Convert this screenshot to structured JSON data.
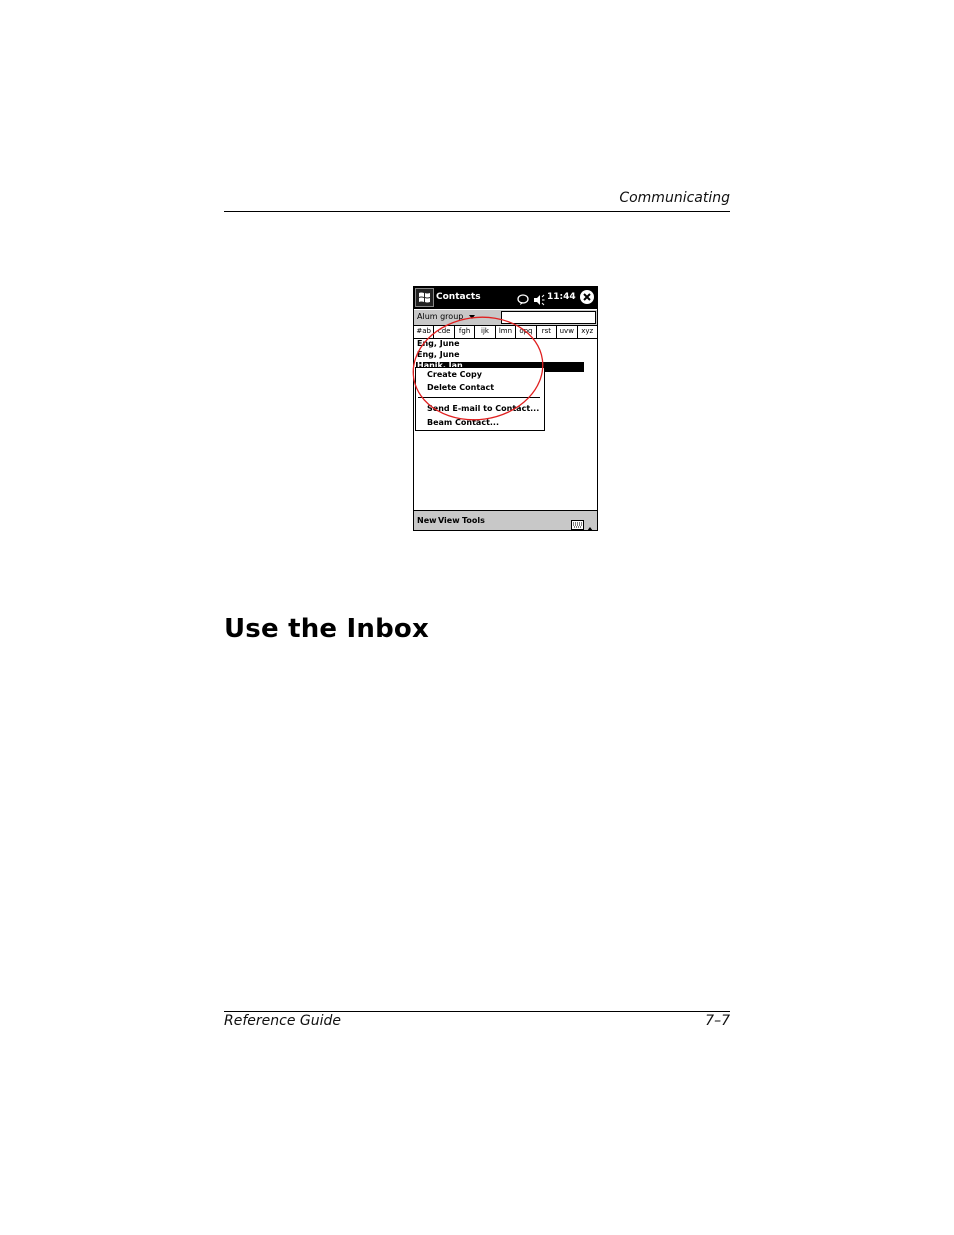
{
  "header": {
    "running_head": "Communicating"
  },
  "device": {
    "app_title": "Contacts",
    "time": "11:44",
    "category_filter": "Alum group",
    "tabs": [
      "#ab",
      "cde",
      "fgh",
      "ijk",
      "lmn",
      "opq",
      "rst",
      "uvw",
      "xyz"
    ],
    "contacts": [
      "Eng, June",
      "Eng, June"
    ],
    "selected_contact": "Hanik, Jan",
    "context_menu": {
      "items": [
        "Create Copy",
        "Delete Contact",
        "Send E-mail to Contact...",
        "Beam Contact..."
      ]
    },
    "bottom_menu": [
      "New",
      "View",
      "Tools"
    ],
    "icons": {
      "start": "windows-flag-icon",
      "notification": "speech-bubble-icon",
      "speaker": "speaker-icon",
      "close": "close-icon",
      "dropdown": "triangle-down-icon",
      "keyboard": "keyboard-icon",
      "sip": "triangle-up-icon"
    },
    "annotation_color": "#e02020"
  },
  "section": {
    "heading": "Use the Inbox"
  },
  "footer": {
    "left": "Reference Guide",
    "right": "7–7"
  }
}
